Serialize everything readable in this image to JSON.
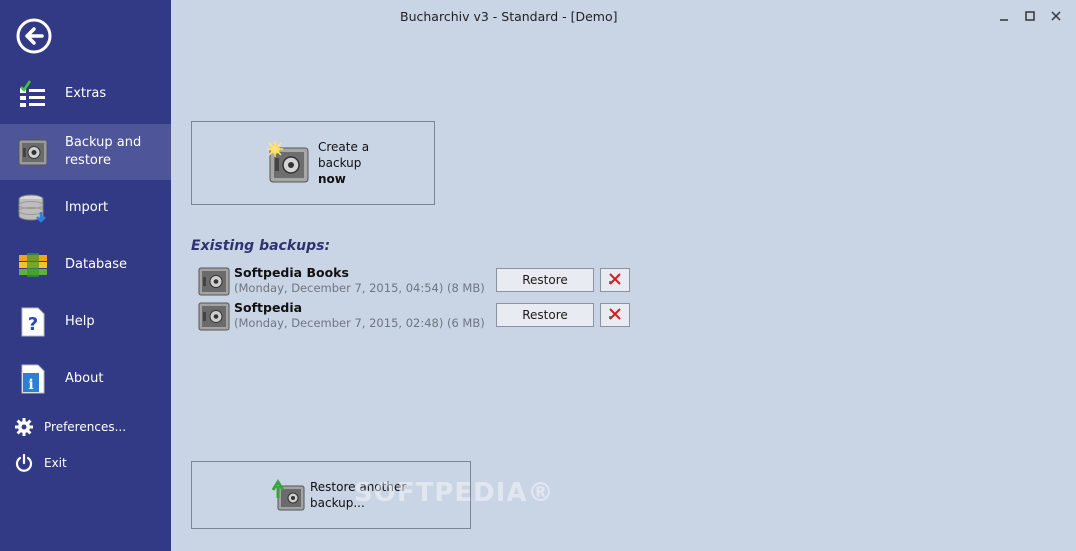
{
  "window": {
    "title": "Bucharchiv v3 - Standard - [Demo]"
  },
  "sidebar": {
    "items": [
      {
        "label": "Extras",
        "icon": "checklist-icon"
      },
      {
        "label": "Backup and\nrestore",
        "icon": "vault-icon",
        "active": true
      },
      {
        "label": "Import",
        "icon": "database-import-icon"
      },
      {
        "label": "Database",
        "icon": "database-icon"
      },
      {
        "label": "Help",
        "icon": "help-document-icon"
      },
      {
        "label": "About",
        "icon": "info-document-icon"
      }
    ],
    "preferences_label": "Preferences...",
    "exit_label": "Exit"
  },
  "main": {
    "create_backup": {
      "line1": "Create a",
      "line2": "backup",
      "line3": "now"
    },
    "existing_title": "Existing backups:",
    "backups": [
      {
        "name": "Softpedia Books",
        "meta": "(Monday, December 7, 2015, 04:54) (8 MB)",
        "restore_label": "Restore"
      },
      {
        "name": "Softpedia",
        "meta": "(Monday, December 7, 2015, 02:48) (6 MB)",
        "restore_label": "Restore"
      }
    ],
    "restore_another": {
      "line1": "Restore another",
      "line2": "backup..."
    },
    "watermark": "SOFTPEDIA®"
  },
  "colors": {
    "sidebar_bg": "#333a85",
    "sidebar_active": "#4e5598",
    "main_bg": "#c9d4e5",
    "section_title": "#2e3470",
    "delete_x": "#d02020"
  }
}
